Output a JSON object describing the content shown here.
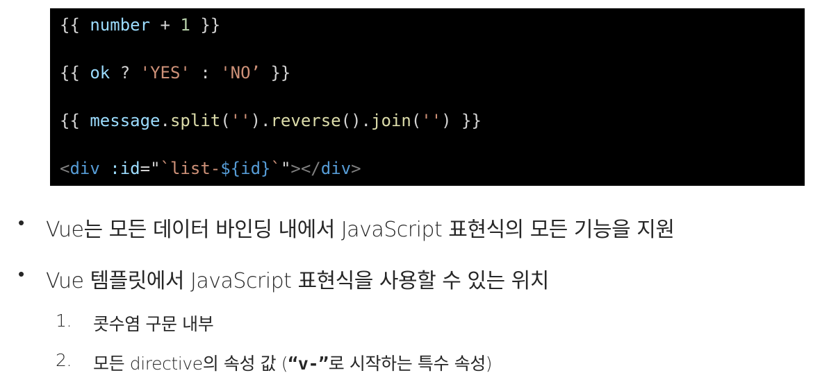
{
  "code": {
    "line1": {
      "open": "{{ ",
      "var": "number",
      "op": " + ",
      "num": "1",
      "close": " }}"
    },
    "line2": {
      "open": "{{ ",
      "var": "ok",
      "op1": " ? ",
      "str1": "'YES'",
      "op2": " : ",
      "str2": "'NO’",
      "close": " }}"
    },
    "line3": {
      "open": "{{ ",
      "var": "message",
      "dot1": ".",
      "fn1": "split",
      "p1": "(",
      "s1": "''",
      "p2": ").",
      "fn2": "reverse",
      "p3": "().",
      "fn3": "join",
      "p4": "(",
      "s2": "''",
      "p5": ")",
      "close": " }}"
    },
    "line4": {
      "lt": "<",
      "tag": "div",
      "sp": " ",
      "attr": ":id",
      "eq": "=\"",
      "tplstart": "`list-",
      "interp": "${id}",
      "tplend": "`",
      "quote": "\"",
      "gtlt": "></",
      "tag2": "div",
      "gt": ">"
    }
  },
  "bullets": [
    {
      "symbol": "•",
      "text": "Vue는 모든 데이터 바인딩 내에서 JavaScript 표현식의 모든 기능을 지원"
    },
    {
      "symbol": "•",
      "text": "Vue 템플릿에서 JavaScript 표현식을 사용할 수 있는 위치"
    }
  ],
  "numbered": [
    {
      "num": "1.",
      "text": "콧수염 구문 내부"
    },
    {
      "num": "2.",
      "text_before": "모든 directive의 속성 값 (",
      "code": "“v-”",
      "text_after": "로 시작하는 특수 속성)"
    }
  ]
}
